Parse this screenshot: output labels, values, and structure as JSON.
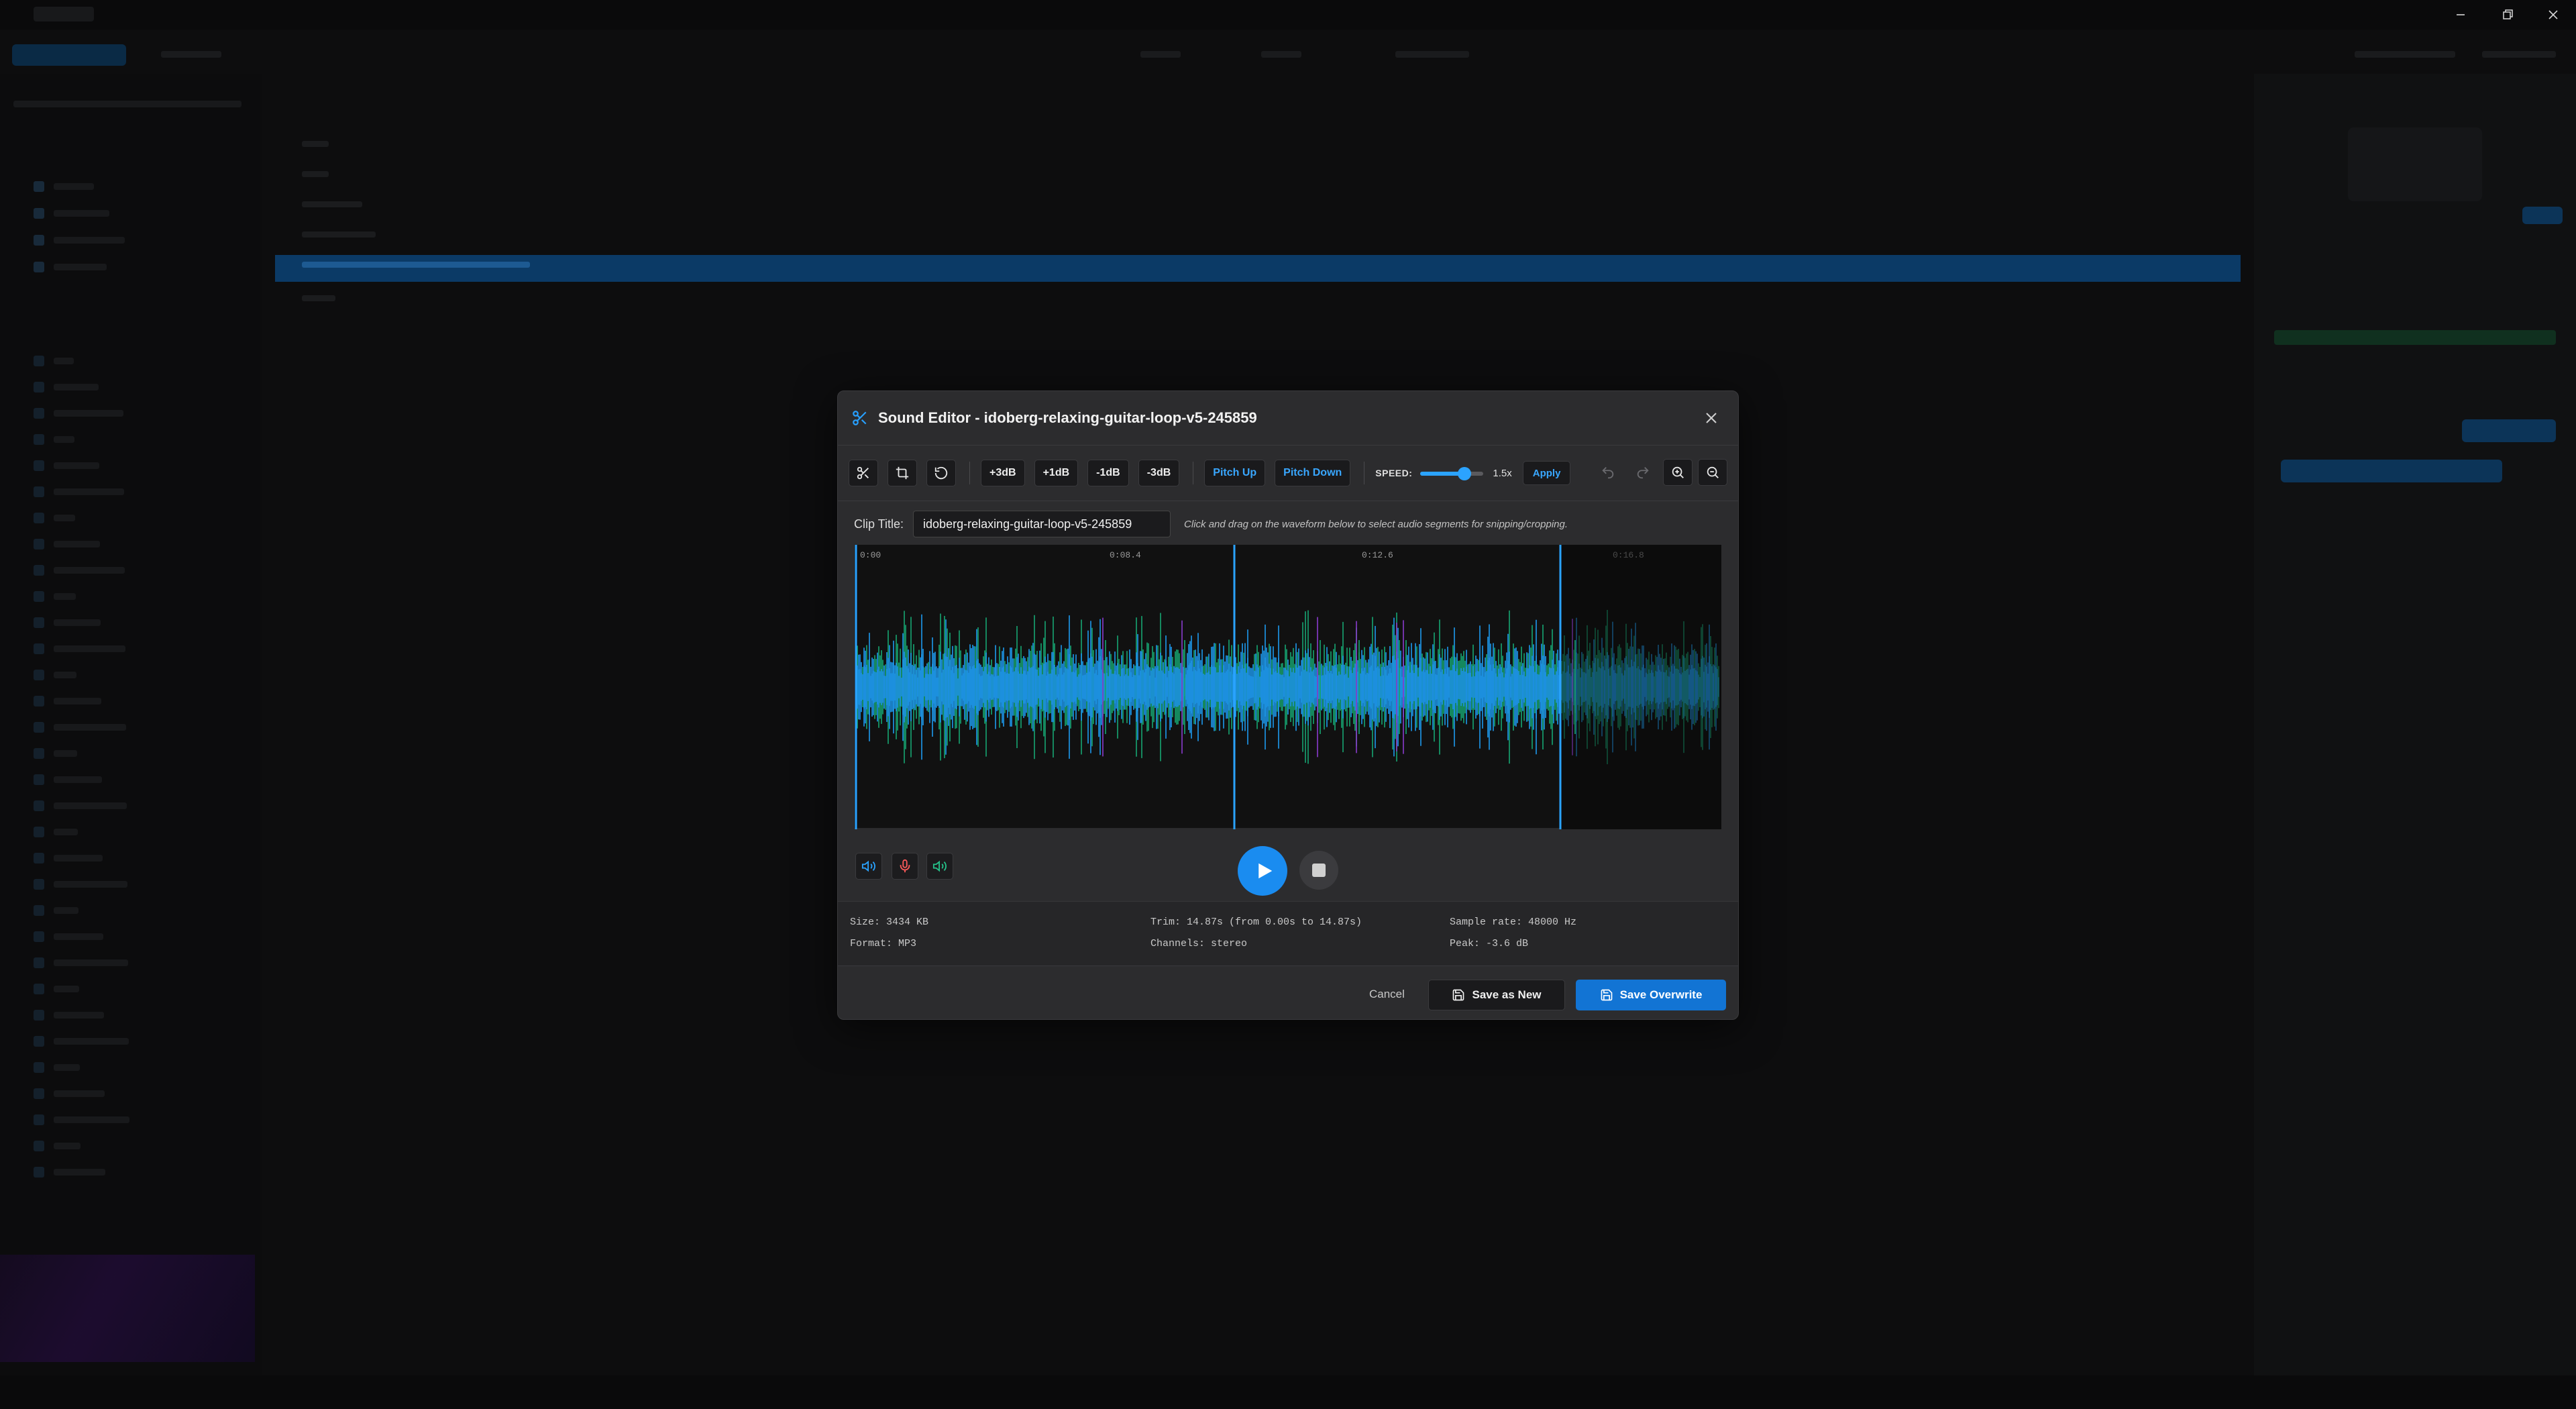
{
  "dialog": {
    "title": "Sound Editor - idoberg-relaxing-guitar-loop-v5-245859",
    "accent_color": "#28a0ff"
  },
  "toolbar": {
    "snip_icon": "scissors-icon",
    "crop_icon": "crop-icon",
    "reset_icon": "reset-icon",
    "gain_buttons": [
      "+3dB",
      "+1dB",
      "-1dB",
      "-3dB"
    ],
    "pitch_up": "Pitch Up",
    "pitch_down": "Pitch Down",
    "speed_label": "SPEED:",
    "speed_value": "1.5x",
    "speed_fraction": 0.7,
    "apply": "Apply",
    "undo_icon": "undo-icon",
    "redo_icon": "redo-icon",
    "zoom_in_icon": "zoom-in-icon",
    "zoom_out_icon": "zoom-out-icon"
  },
  "clip": {
    "label": "Clip Title:",
    "value": "idoberg-relaxing-guitar-loop-v5-245859",
    "hint": "Click and drag on the waveform below to select audio segments for snipping/cropping."
  },
  "waveform": {
    "ticks": [
      "0:00",
      "0:08.4",
      "0:12.6",
      "0:16.8"
    ],
    "colors": {
      "blue": "#1e9bf0",
      "green": "#17a673",
      "purple": "#8a3ccf",
      "marker": "#2aa3ff"
    }
  },
  "playback": {
    "icons": [
      "volume-icon",
      "microphone-icon",
      "speaker-icon"
    ],
    "play_icon": "play-icon",
    "stop_icon": "stop-icon"
  },
  "info": {
    "size": "Size: 3434 KB",
    "format": "Format: MP3",
    "trim": "Trim: 14.87s (from 0.00s to 14.87s)",
    "channels": "Channels: stereo",
    "sample_rate": "Sample rate: 48000 Hz",
    "peak": "Peak: -3.6 dB"
  },
  "footer": {
    "cancel": "Cancel",
    "save_new": "Save as New",
    "save_overwrite": "Save Overwrite"
  }
}
